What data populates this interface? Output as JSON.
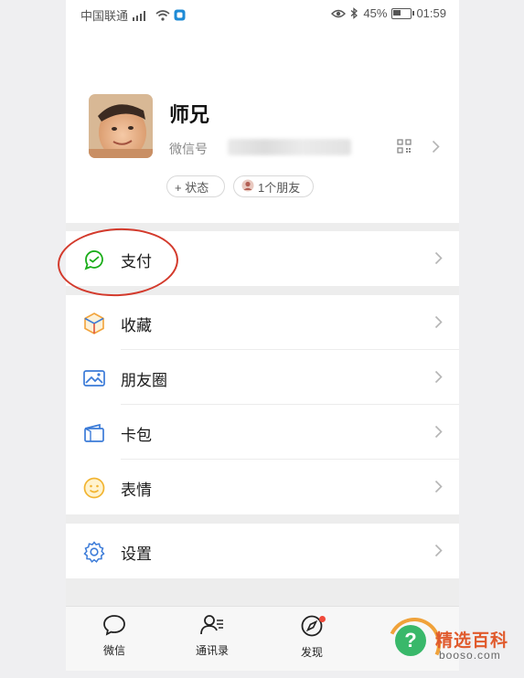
{
  "status_bar": {
    "carrier": "中国联通",
    "signal_text": "⁴ᴳ",
    "battery_percent": "45%",
    "battery_level": 0.45,
    "time": "01:59"
  },
  "profile": {
    "name": "师兄",
    "wechat_id_label": "微信号",
    "status_chip": "+ 状态",
    "friends_chip": "1个朋友"
  },
  "menu": {
    "pay": "支付",
    "favorites": "收藏",
    "moments": "朋友圈",
    "cards": "卡包",
    "stickers": "表情",
    "settings": "设置"
  },
  "tabbar": {
    "chats": "微信",
    "contacts": "通讯录",
    "discover": "发现"
  },
  "watermark": {
    "title": "精选百科",
    "site": "booso.com",
    "symbol": "?"
  },
  "colors": {
    "pay_green": "#1aad19",
    "accent_blue": "#3b7bd8",
    "highlight_red": "#d33a2c",
    "badge_red": "#f0493a"
  },
  "icons": [
    "qr-code-icon",
    "chevron-right-icon",
    "pay-icon",
    "favorites-icon",
    "moments-icon",
    "cards-icon",
    "stickers-icon",
    "settings-icon",
    "chat-icon",
    "contacts-icon",
    "discover-icon"
  ]
}
